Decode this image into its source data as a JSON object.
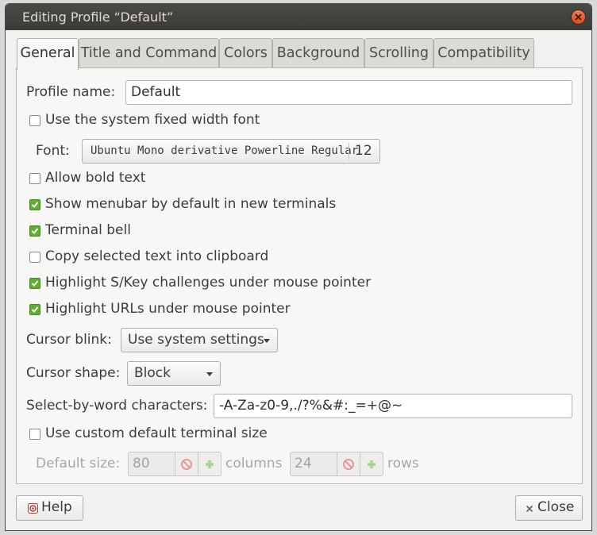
{
  "window": {
    "title": "Editing Profile “Default”"
  },
  "tabs": [
    {
      "label": "General",
      "active": true
    },
    {
      "label": "Title and Command"
    },
    {
      "label": "Colors"
    },
    {
      "label": "Background"
    },
    {
      "label": "Scrolling"
    },
    {
      "label": "Compatibility"
    }
  ],
  "general": {
    "profile_name_label": "Profile name:",
    "profile_name_value": "Default",
    "system_font_label": "Use the system fixed width font",
    "font_label": "Font:",
    "font_name": "Ubuntu Mono derivative Powerline Regular",
    "font_size": "12",
    "checkboxes": [
      {
        "label": "Allow bold text",
        "checked": false
      },
      {
        "label": "Show menubar by default in new terminals",
        "checked": true
      },
      {
        "label": "Terminal bell",
        "checked": true
      },
      {
        "label": "Copy selected text into clipboard",
        "checked": false
      },
      {
        "label": "Highlight S/Key challenges under mouse pointer",
        "checked": true
      },
      {
        "label": "Highlight URLs under mouse pointer",
        "checked": true
      }
    ],
    "cursor_blink_label": "Cursor blink:",
    "cursor_blink_value": "Use system settings",
    "cursor_shape_label": "Cursor shape:",
    "cursor_shape_value": "Block",
    "select_word_label": "Select-by-word characters:",
    "select_word_value": "-A-Za-z0-9,./?%&#:_=+@~",
    "custom_size_label": "Use custom default terminal size",
    "default_size_label": "Default size:",
    "columns_value": "80",
    "columns_label": "columns",
    "rows_value": "24",
    "rows_label": "rows"
  },
  "footer": {
    "help_label": "Help",
    "close_label": "Close"
  },
  "colors": {
    "check_green": "#5fae2f",
    "titlebar": "#3c3b37",
    "close_orange": "#df4a16"
  }
}
